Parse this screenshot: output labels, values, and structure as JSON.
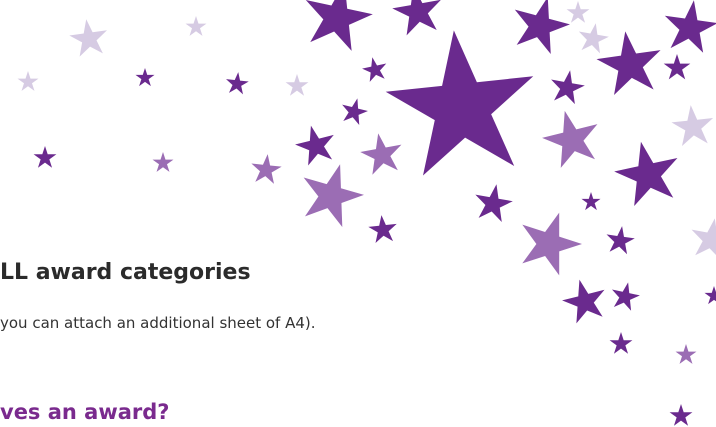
{
  "colors": {
    "dark_purple": "#6a2a8e",
    "mid_purple": "#9b6db4",
    "light_purple": "#d6cbe3",
    "heading2_color": "#7a2a8e"
  },
  "decoration": {
    "icon": "star-icon",
    "description": "scattered purple star confetti"
  },
  "content": {
    "heading1": "LL award categories",
    "body1": "you can attach an additional sheet of A4).",
    "heading2": "ves an award?"
  }
}
